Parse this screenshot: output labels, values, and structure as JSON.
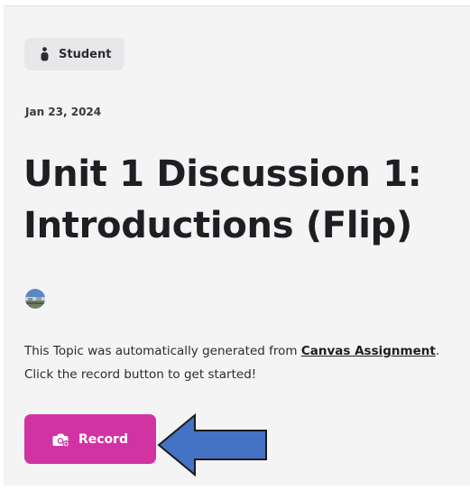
{
  "role_badge": {
    "label": "Student",
    "icon": "person-icon"
  },
  "topic": {
    "date": "Jan 23, 2024",
    "title": "Unit 1 Discussion 1: Introductions (Flip)",
    "description_prefix": "This Topic was automatically generated from ",
    "description_link": "Canvas Assignment",
    "description_suffix": ". Click the record button to get started!"
  },
  "record_button": {
    "label": "Record",
    "icon": "camera-plus-icon"
  },
  "annotation": {
    "arrow_color": "#4472c4",
    "arrow_direction": "left",
    "arrow_icon": "arrow-left-icon"
  },
  "colors": {
    "background": "#f4f4f5",
    "accent": "#d133a3"
  }
}
